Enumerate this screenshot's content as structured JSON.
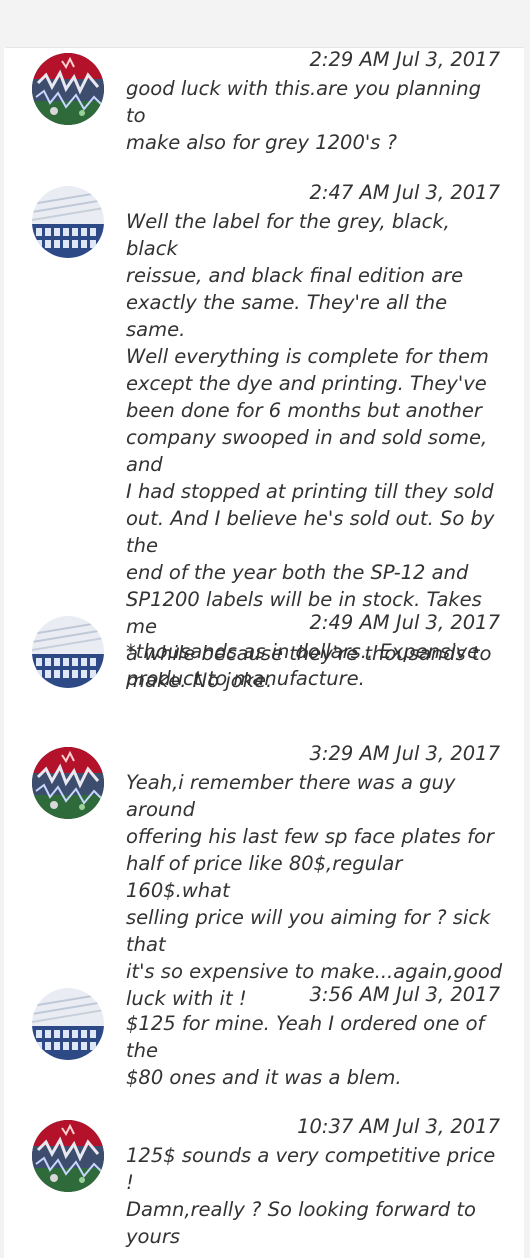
{
  "messages": [
    {
      "user": "graffiti",
      "avatar_icon": "graffiti-avatar-icon",
      "time": "2:29 AM Jul 3, 2017",
      "text": " good luck with this.are you planning to\n make also for grey 1200's ?"
    },
    {
      "user": "keyboard",
      "avatar_icon": "keyboard-avatar-icon",
      "time": "2:47 AM Jul 3, 2017",
      "text": "  Well the label for the grey, black, black\n  reissue, and black final edition are\nexactly the same. They're all the same.\nWell everything is complete for them\nexcept the dye and printing. They've\nbeen done for 6 months but another\ncompany swooped in and sold some, and\nI had stopped at printing till they sold\nout. And I believe he's sold out. So by the\nend of the year both the SP-12 and\nSP1200 labels will be in stock. Takes me\na while because they're thousands to\nmake. No joke."
    },
    {
      "user": "keyboard",
      "avatar_icon": "keyboard-avatar-icon",
      "time": "2:49 AM Jul 3, 2017",
      "text": " *thousands as in dollars.. Expensive\n product to manufacture."
    },
    {
      "user": "graffiti",
      "avatar_icon": "graffiti-avatar-icon",
      "time": "3:29 AM Jul 3, 2017",
      "text": " Yeah,i remember there was a guy around\n  offering his last few sp face plates for\nhalf of price like 80$,regular 160$.what\nselling price will you aiming for ? sick that\nit's so expensive to make...again,good\nluck with it !"
    },
    {
      "user": "keyboard",
      "avatar_icon": "keyboard-avatar-icon",
      "time": "3:56 AM Jul 3, 2017",
      "text": " $125 for mine. Yeah I ordered one of the\n $80 ones and it was a blem."
    },
    {
      "user": "graffiti",
      "avatar_icon": "graffiti-avatar-icon",
      "time": "10:37 AM Jul 3, 2017",
      "text": " 125$ sounds a very competitive price !\n  Damn,really ? So looking forward to\nyours"
    }
  ]
}
